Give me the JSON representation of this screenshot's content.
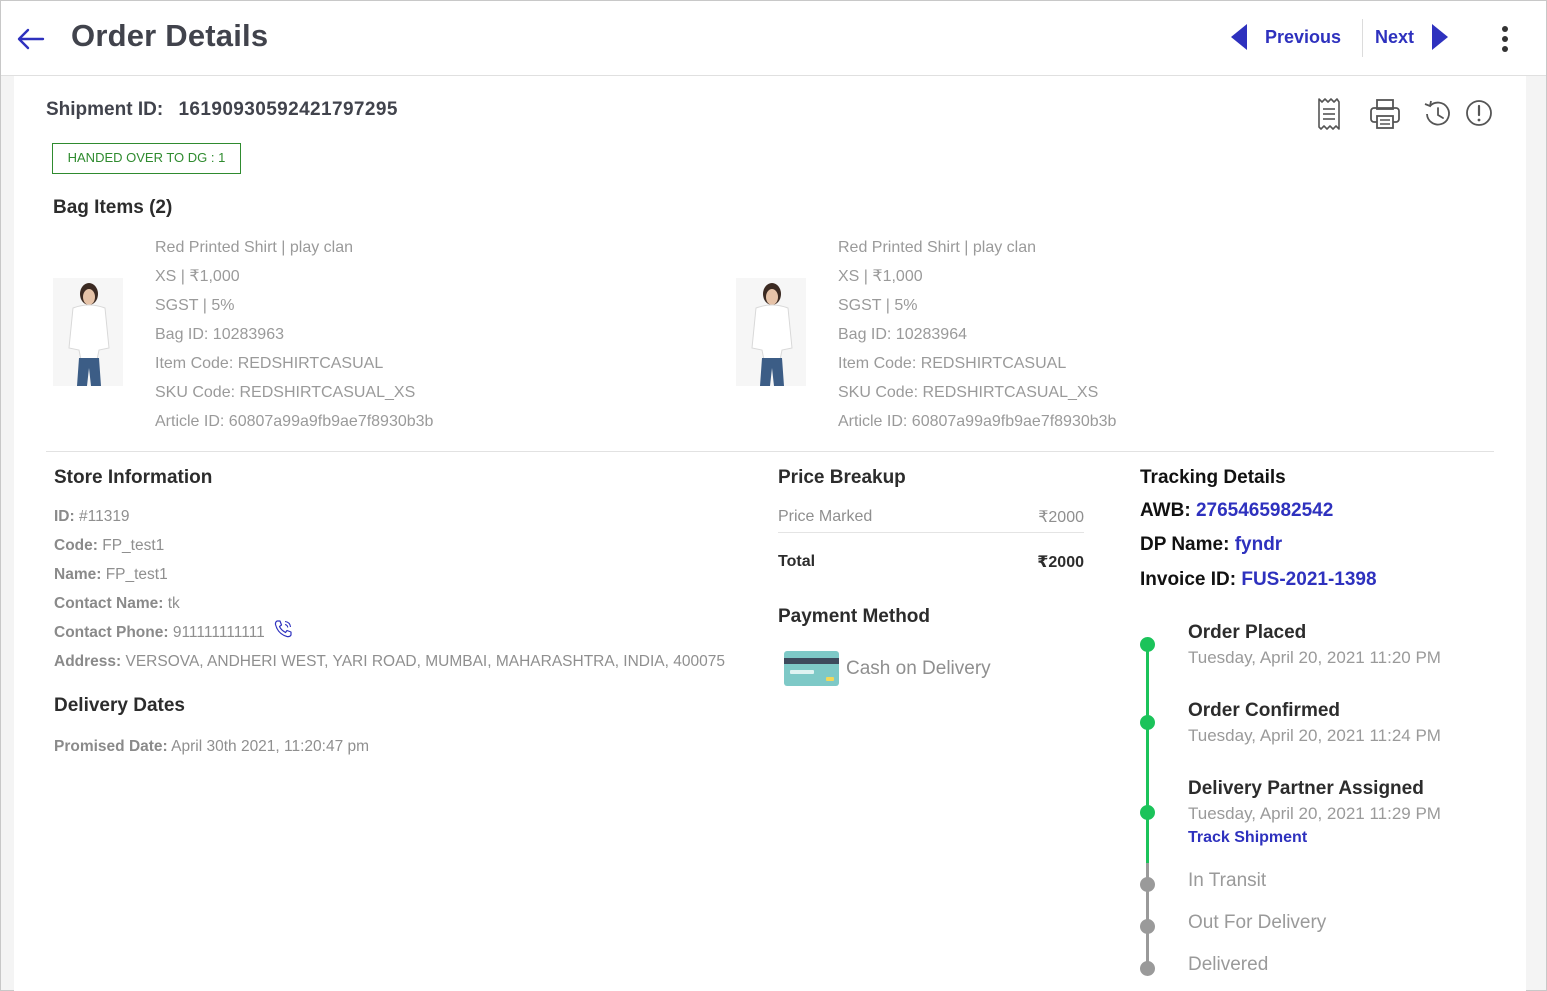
{
  "header": {
    "title": "Order Details",
    "previous_label": "Previous",
    "next_label": "Next",
    "accent_color": "#2e31be"
  },
  "shipment": {
    "label": "Shipment ID:",
    "id": "16190930592421797295",
    "status": "HANDED OVER TO DG : 1",
    "status_color": "#2f8b2f",
    "tools": [
      "receipt-icon",
      "printer-icon",
      "history-icon",
      "alert-icon"
    ]
  },
  "bag": {
    "title": "Bag Items (2)",
    "items": [
      {
        "line1": "Red Printed Shirt | play clan",
        "line2": "XS | ₹1,000",
        "line3": "SGST | 5%",
        "line4": "Bag ID: 10283963",
        "line5": "Item Code: REDSHIRTCASUAL",
        "line6": "SKU Code: REDSHIRTCASUAL_XS",
        "line7": "Article ID: 60807a99a9fb9ae7f8930b3b"
      },
      {
        "line1": "Red Printed Shirt | play clan",
        "line2": "XS | ₹1,000",
        "line3": "SGST | 5%",
        "line4": "Bag ID: 10283964",
        "line5": "Item Code: REDSHIRTCASUAL",
        "line6": "SKU Code: REDSHIRTCASUAL_XS",
        "line7": "Article ID: 60807a99a9fb9ae7f8930b3b"
      }
    ]
  },
  "store": {
    "title": "Store Information",
    "id_label": "ID:",
    "id_value": "#11319",
    "code_label": "Code:",
    "code_value": "FP_test1",
    "name_label": "Name:",
    "name_value": "FP_test1",
    "contact_name_label": "Contact Name:",
    "contact_name_value": "tk",
    "contact_phone_label": "Contact Phone:",
    "contact_phone_value": "911111111111",
    "address_label": "Address:",
    "address_value": "VERSOVA, ANDHERI WEST, YARI ROAD, MUMBAI, MAHARASHTRA, INDIA, 400075"
  },
  "delivery": {
    "title": "Delivery Dates",
    "promised_label": "Promised Date:",
    "promised_value": "April 30th 2021, 11:20:47 pm"
  },
  "price": {
    "title": "Price Breakup",
    "marked_label": "Price Marked",
    "marked_value": "₹2000",
    "total_label": "Total",
    "total_value": "₹2000"
  },
  "payment": {
    "title": "Payment Method",
    "method": "Cash on Delivery"
  },
  "tracking": {
    "title": "Tracking Details",
    "awb_label": "AWB:",
    "awb_value": "2765465982542",
    "dp_label": "DP Name:",
    "dp_value": "fyndr",
    "invoice_label": "Invoice ID:",
    "invoice_value": "FUS-2021-1398",
    "done_color": "#1bc35a",
    "pending_color": "#9a9a9a",
    "steps": [
      {
        "label": "Order Placed",
        "date": "Tuesday, April 20, 2021 11:20 PM",
        "done": true
      },
      {
        "label": "Order Confirmed",
        "date": "Tuesday, April 20, 2021 11:24 PM",
        "done": true
      },
      {
        "label": "Delivery Partner Assigned",
        "date": "Tuesday, April 20, 2021 11:29 PM",
        "done": true,
        "link": "Track Shipment"
      },
      {
        "label": "In Transit",
        "done": false
      },
      {
        "label": "Out For Delivery",
        "done": false
      },
      {
        "label": "Delivered",
        "done": false
      }
    ]
  }
}
